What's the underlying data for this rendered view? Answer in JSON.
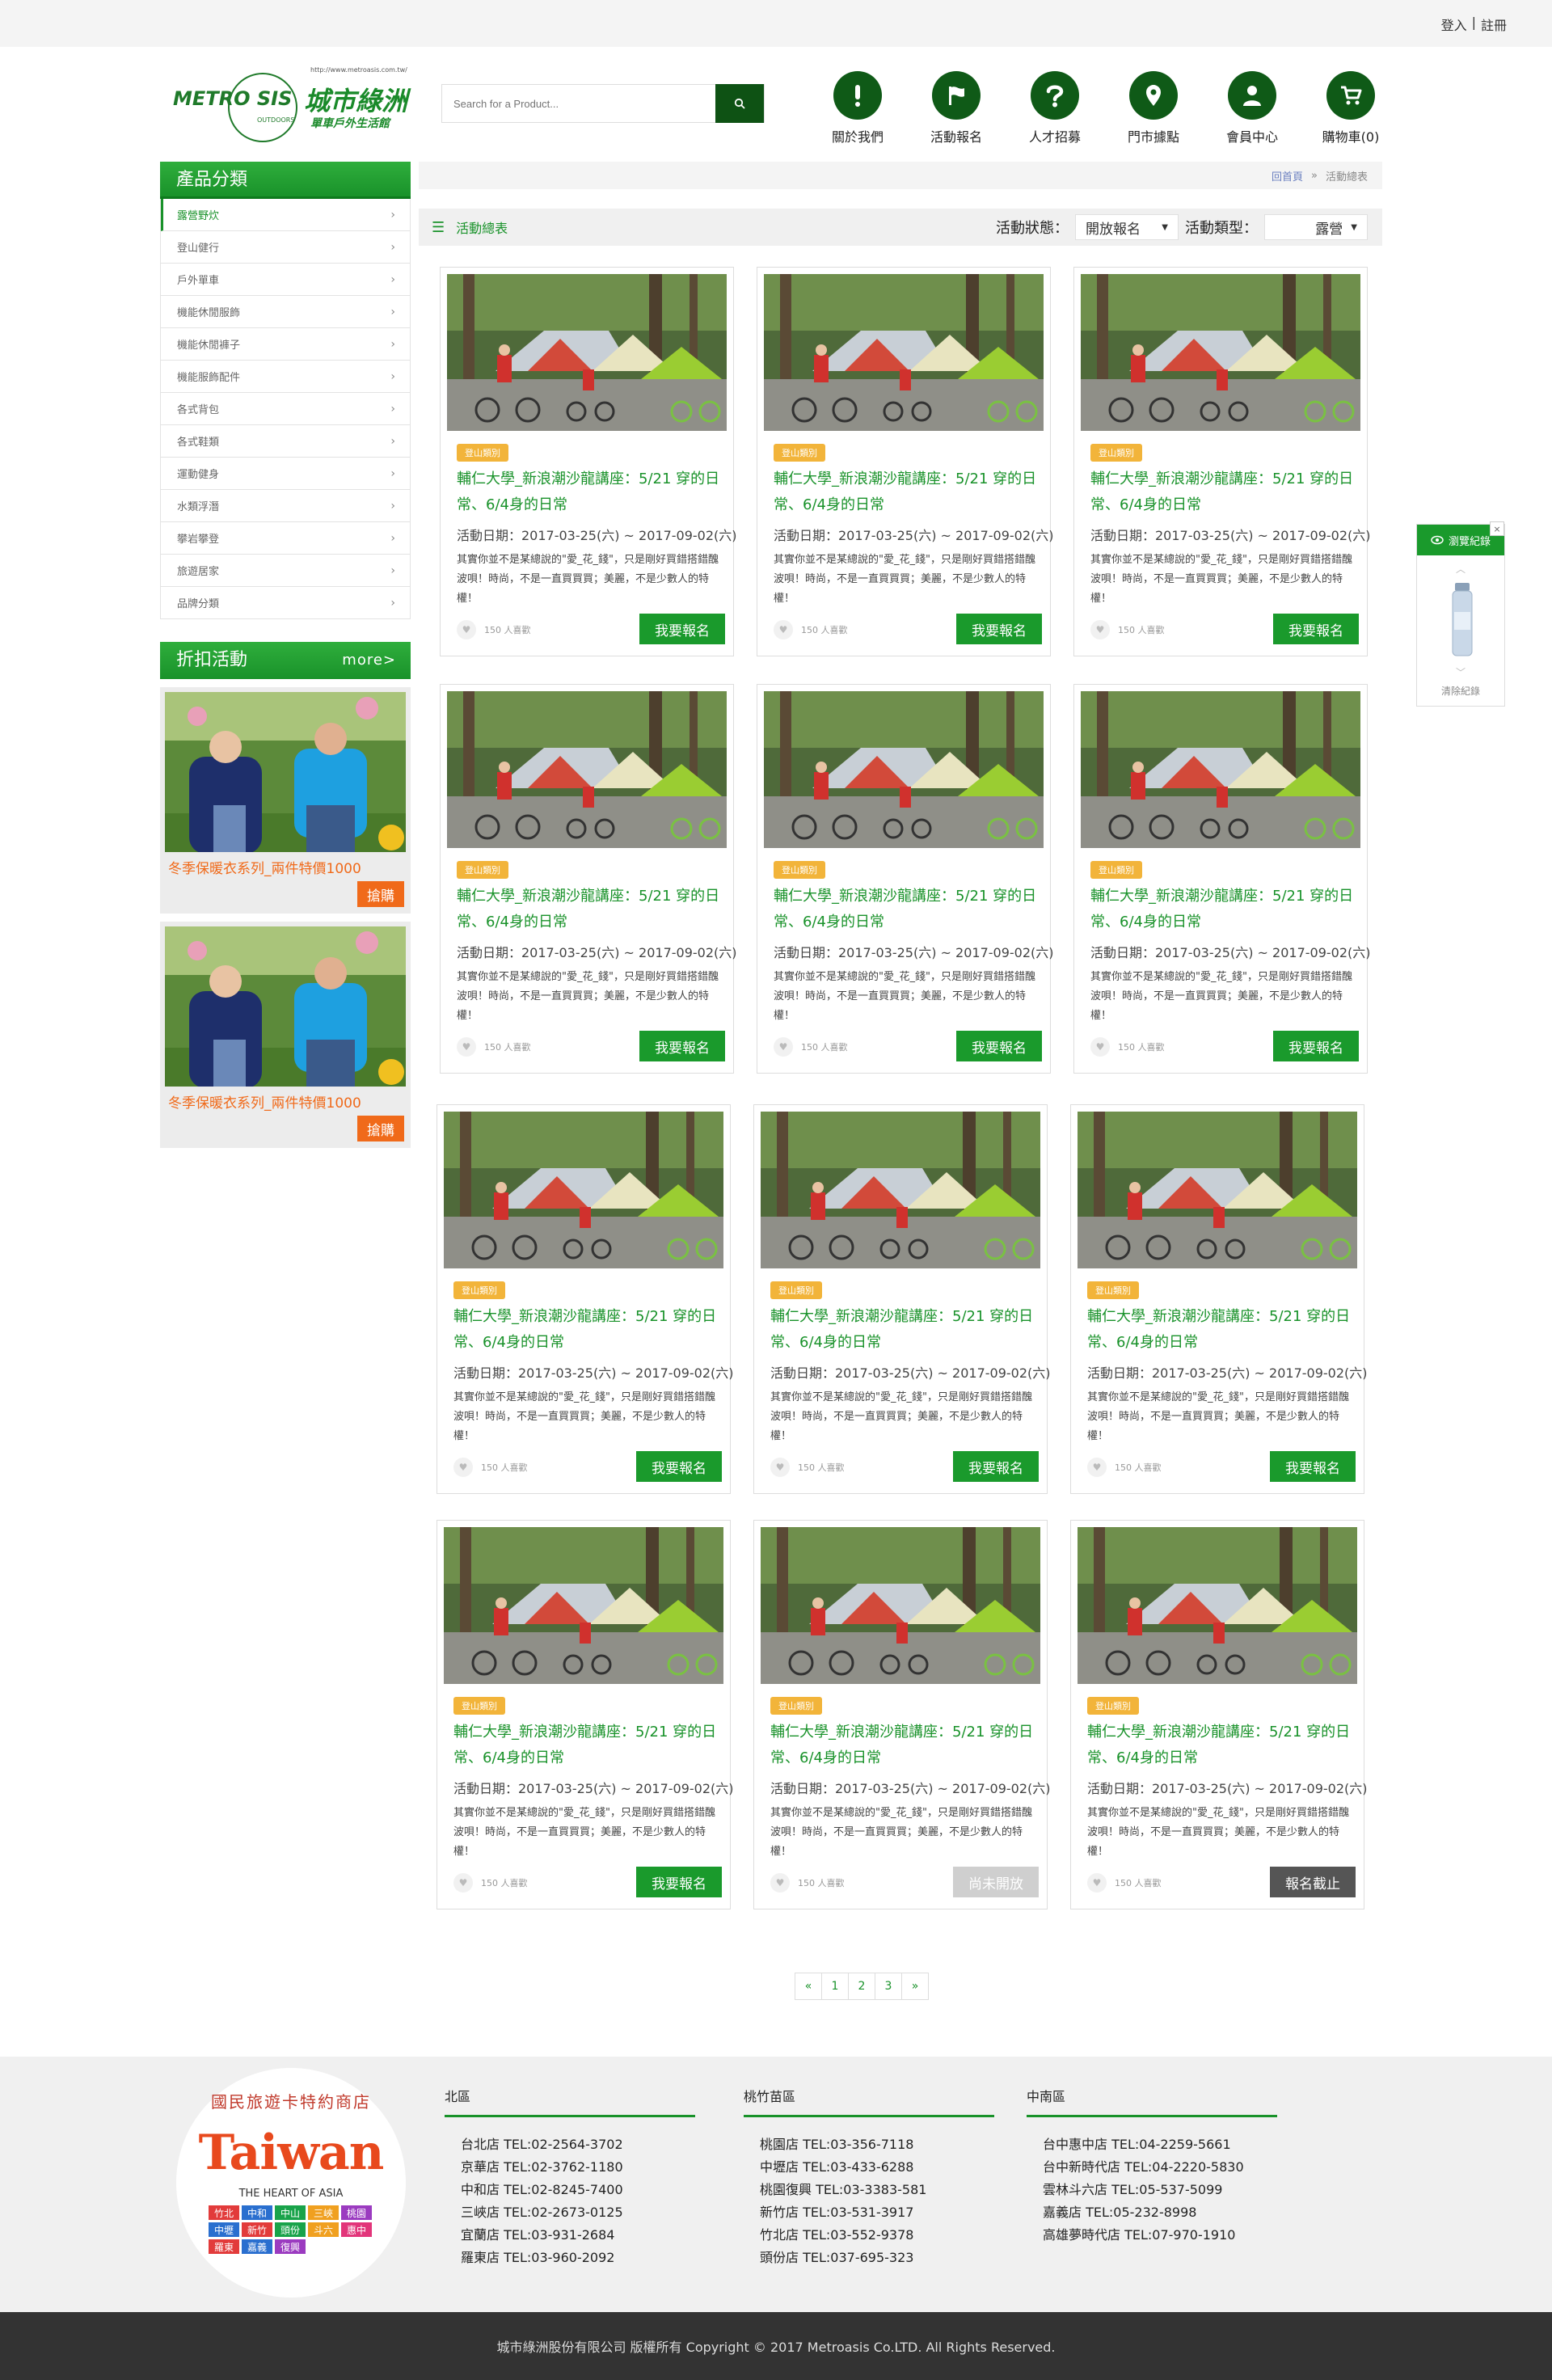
{
  "topbar": {
    "login": "登入",
    "sep": "|",
    "register": "註冊"
  },
  "logo": {
    "url": "http://www.metroasis.com.tw/",
    "brand_en": "METRO  SIS",
    "outdoors": "OUTDOORS",
    "brand_zh": "城市綠洲",
    "slogan": "單車戶外生活館"
  },
  "search": {
    "placeholder": "Search for a Product..."
  },
  "nav": [
    {
      "label": "關於我們",
      "icon": "exclamation-icon"
    },
    {
      "label": "活動報名",
      "icon": "flag-icon"
    },
    {
      "label": "人才招募",
      "icon": "question-icon"
    },
    {
      "label": "門市據點",
      "icon": "location-pin-icon"
    },
    {
      "label": "會員中心",
      "icon": "user-icon"
    },
    {
      "label": "購物車(0)",
      "icon": "cart-icon"
    }
  ],
  "sidebar": {
    "title": "產品分類",
    "items": [
      "露營野炊",
      "登山健行",
      "戶外單車",
      "機能休閒服飾",
      "機能休閒褲子",
      "機能服飾配件",
      "各式背包",
      "各式鞋類",
      "運動健身",
      "水類浮潛",
      "攀岩攀登",
      "旅遊居家",
      "品牌分類"
    ],
    "promo_title": "折扣活動",
    "promo_more": "more>",
    "promos": [
      {
        "text": "冬季保暖衣系列_兩件特價1000",
        "button": "搶購"
      },
      {
        "text": "冬季保暖衣系列_兩件特價1000",
        "button": "搶購"
      }
    ]
  },
  "breadcrumb": {
    "home": "回首頁",
    "sep": "»",
    "current": "活動總表"
  },
  "filter": {
    "title": "活動總表",
    "status_label": "活動狀態：",
    "status_value": "開放報名",
    "type_label": "活動類型：",
    "type_value": "露營"
  },
  "card_common": {
    "tag": "登山類別",
    "title": "輔仁大學_新浪潮沙龍講座：5/21 穿的日常、6/4身的日常",
    "date": "活動日期：2017-03-25(六) ~ 2017-09-02(六)",
    "desc": "其實你並不是某總說的\"愛_花_錢\"，只是剛好買錯搭錯醜波唄！時尚，不是一直買買買；美麗，不是少數人的特權！",
    "likes": "150 人喜歡"
  },
  "cards": [
    {
      "action": "我要報名",
      "state": "open"
    },
    {
      "action": "我要報名",
      "state": "open"
    },
    {
      "action": "我要報名",
      "state": "open"
    },
    {
      "action": "我要報名",
      "state": "open"
    },
    {
      "action": "我要報名",
      "state": "open"
    },
    {
      "action": "我要報名",
      "state": "open"
    },
    {
      "action": "我要報名",
      "state": "open"
    },
    {
      "action": "我要報名",
      "state": "open"
    },
    {
      "action": "我要報名",
      "state": "open"
    },
    {
      "action": "我要報名",
      "state": "open"
    },
    {
      "action": "尚未開放",
      "state": "notyet"
    },
    {
      "action": "報名截止",
      "state": "closed"
    }
  ],
  "recent": {
    "title": "瀏覽紀錄",
    "close": "×",
    "clear": "清除紀錄"
  },
  "pager": [
    "«",
    "1",
    "2",
    "3",
    "»"
  ],
  "footer": {
    "badge": {
      "arc": "國民旅遊卡特約商店",
      "big": "Taiwan",
      "sub": "THE HEART OF ASIA",
      "stores": [
        {
          "n": "竹北",
          "c": "#e23b3b"
        },
        {
          "n": "中和",
          "c": "#2a6fcf"
        },
        {
          "n": "中山",
          "c": "#19a34a"
        },
        {
          "n": "三峽",
          "c": "#f0a020"
        },
        {
          "n": "桃園",
          "c": "#9b3bc0"
        },
        {
          "n": "中壢",
          "c": "#2a6fcf"
        },
        {
          "n": "新竹",
          "c": "#e23b3b"
        },
        {
          "n": "頭份",
          "c": "#19a34a"
        },
        {
          "n": "斗六",
          "c": "#f0a020"
        },
        {
          "n": "惠中",
          "c": "#e2357a"
        },
        {
          "n": "羅東",
          "c": "#e23b3b"
        },
        {
          "n": "嘉義",
          "c": "#2a6fcf"
        },
        {
          "n": "復興",
          "c": "#9b3bc0"
        }
      ]
    },
    "regions": [
      {
        "title": "北區",
        "stores": [
          "台北店  TEL:02-2564-3702",
          "京華店  TEL:02-3762-1180",
          "中和店  TEL:02-8245-7400",
          "三峽店  TEL:02-2673-0125",
          "宜蘭店  TEL:03-931-2684",
          "羅東店  TEL:03-960-2092"
        ]
      },
      {
        "title": "桃竹苗區",
        "stores": [
          "桃園店  TEL:03-356-7118",
          "中壢店  TEL:03-433-6288",
          "桃園復興  TEL:03-3383-581",
          "新竹店  TEL:03-531-3917",
          "竹北店  TEL:03-552-9378",
          "頭份店  TEL:037-695-323"
        ]
      },
      {
        "title": "中南區",
        "stores": [
          "台中惠中店  TEL:04-2259-5661",
          "台中新時代店 TEL:04-2220-5830",
          "雲林斗六店 TEL:05-537-5099",
          "嘉義店 TEL:05-232-8998",
          "高雄夢時代店 TEL:07-970-1910"
        ]
      }
    ],
    "copyright": "城市綠洲股份有限公司 版權所有 Copyright © 2017 Metroasis Co.LTD. All Rights Reserved."
  }
}
